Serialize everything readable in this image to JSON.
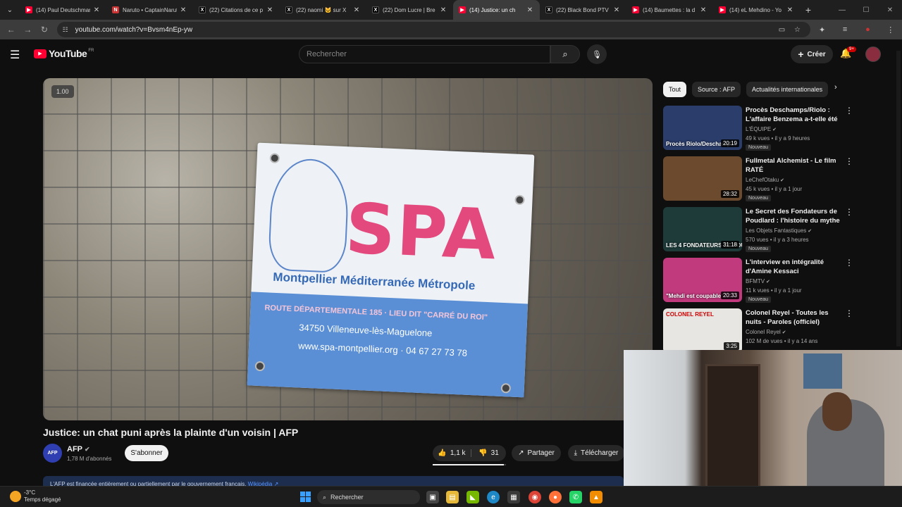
{
  "browser": {
    "tabs": [
      {
        "label": "(14) Paul Deutschmann",
        "icon": "youtube-icon",
        "active": false
      },
      {
        "label": "Naruto • CaptainNaruto",
        "icon": "naruto-icon",
        "active": false
      },
      {
        "label": "(22) Citations de ce p",
        "icon": "x-icon",
        "active": false
      },
      {
        "label": "(22) naomi 🐱 sur X",
        "icon": "x-icon",
        "active": false
      },
      {
        "label": "(22) Dom Lucre | Bre",
        "icon": "x-icon",
        "active": false
      },
      {
        "label": "(14) Justice: un ch",
        "icon": "youtube-icon",
        "active": true
      },
      {
        "label": "(22) Black Bond PTV",
        "icon": "x-icon",
        "active": false
      },
      {
        "label": "(14) Baumettes : la d",
        "icon": "youtube-icon",
        "active": false
      },
      {
        "label": "(14) eL Mehdino - Yo",
        "icon": "youtube-icon",
        "active": false
      }
    ],
    "url": "youtube.com/watch?v=Bvsm4nEp-yw"
  },
  "youtube": {
    "logo_text": "YouTube",
    "country": "FR",
    "search_placeholder": "Rechercher",
    "create_label": "Créer",
    "notif_count": "9+"
  },
  "video": {
    "speed": "1.00",
    "sign_main": "SPA",
    "sign_sub": "Montpellier Méditerranée Métropole",
    "sign_line1": "ROUTE DÉPARTEMENTALE 185 · LIEU DIT \"CARRÉ DU ROI\"",
    "sign_line2": "34750 Villeneuve-lès-Maguelone",
    "sign_line3": "www.spa-montpellier.org · 04 67 27 73 78",
    "title": "Justice: un chat puni après la plainte d'un voisin | AFP",
    "channel": "AFP",
    "channel_avatar": "AFP",
    "subscribers": "1,78 M d'abonnés",
    "subscribe_label": "S'abonner",
    "likes": "1,1 k",
    "dislikes": "31",
    "like_ratio": 0.97,
    "share_label": "Partager",
    "download_label": "Télécharger",
    "info_text": "L'AFP est financée entièrement ou partiellement par le gouvernement français.",
    "info_link": "Wikipédia ↗"
  },
  "chips": [
    "Tout",
    "Source : AFP",
    "Actualités internationales"
  ],
  "recommendations": [
    {
      "title": "Procès Deschamps/Riolo : L'affaire Benzema a-t-elle été ...",
      "channel": "L'ÉQUIPE",
      "meta": "49 k vues • il y a 9 heures",
      "badge": "Nouveau",
      "duration": "20:19",
      "caption": "Procès Riolo/Deschamps",
      "thumb_color": "#2b3d6b"
    },
    {
      "title": "Fullmetal Alchemist - Le film RATÉ",
      "channel": "LeChefOtaku",
      "meta": "45 k vues • il y a 1 jour",
      "badge": "Nouveau",
      "duration": "28:32",
      "caption": "",
      "thumb_color": "#6b4a2e"
    },
    {
      "title": "Le Secret des Fondateurs de Poudlard : l'histoire du mythe ...",
      "channel": "Les Objets Fantastiques",
      "meta": "570 vues • il y a 3 heures",
      "badge": "Nouveau",
      "duration": "31:18",
      "caption": "LES 4 FONDATEURS DE POUDLARD",
      "thumb_color": "#1e3b3a"
    },
    {
      "title": "L'interview en intégralité d'Amine Kessaci",
      "channel": "BFMTV",
      "meta": "11 k vues • il y a 1 jour",
      "badge": "Nouveau",
      "duration": "20:33",
      "caption": "\"Mehdi est coupable\"",
      "thumb_color": "#c23a7e"
    },
    {
      "title": "Colonel Reyel - Toutes les nuits - Paroles (officiel)",
      "channel": "Colonel Reyel",
      "meta": "102 M de vues • il y a 14 ans",
      "badge": "",
      "duration": "3:25",
      "caption": "COLONEL REYEL",
      "thumb_color": "#e8e6e2"
    }
  ],
  "taskbar": {
    "temperature": "-3°C",
    "weather": "Temps dégagé",
    "search_placeholder": "Rechercher"
  }
}
